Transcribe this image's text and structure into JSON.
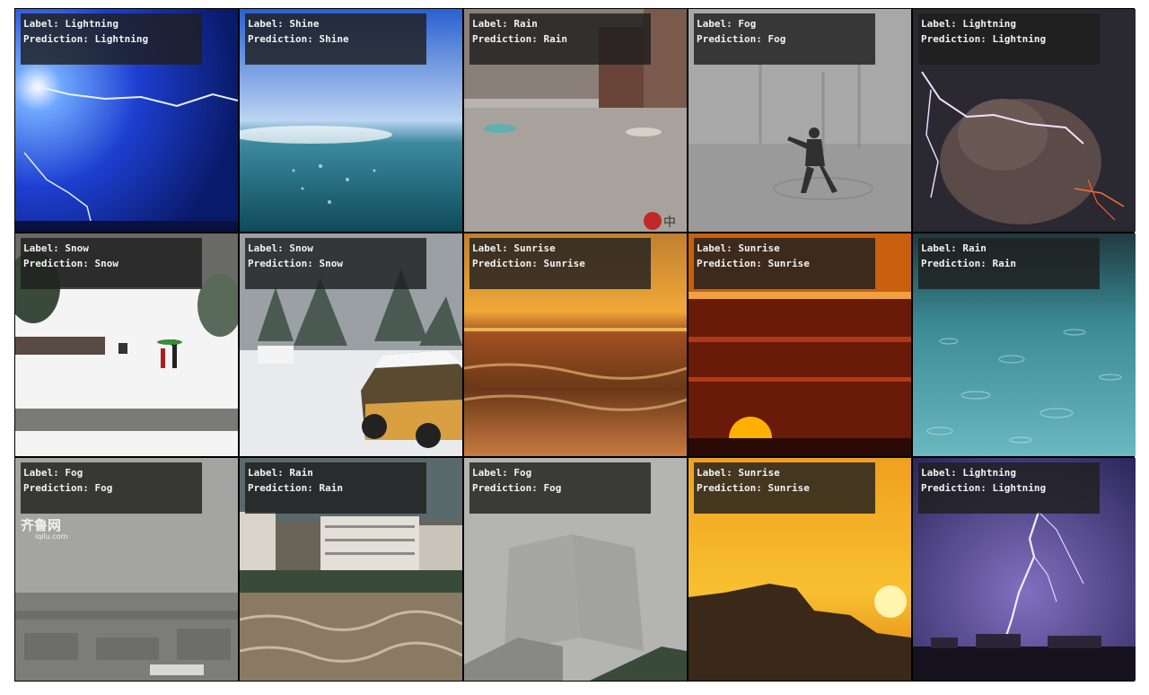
{
  "tiles": [
    {
      "label": "Label: Lightning",
      "prediction": "Prediction: Lightning",
      "scene": "lightning-sky-icon"
    },
    {
      "label": "Label: Shine",
      "prediction": "Prediction: Shine",
      "scene": "sunny-sea-icon"
    },
    {
      "label": "Label: Rain",
      "prediction": "Prediction: Rain",
      "scene": "flooded-street-icon"
    },
    {
      "label": "Label: Fog",
      "prediction": "Prediction: Fog",
      "scene": "foggy-person-icon"
    },
    {
      "label": "Label: Lightning",
      "prediction": "Prediction: Lightning",
      "scene": "volcanic-lightning-icon"
    },
    {
      "label": "Label: Snow",
      "prediction": "Prediction: Snow",
      "scene": "snowy-park-icon"
    },
    {
      "label": "Label: Snow",
      "prediction": "Prediction: Snow",
      "scene": "snowy-car-icon"
    },
    {
      "label": "Label: Sunrise",
      "prediction": "Prediction: Sunrise",
      "scene": "sunrise-beach-icon"
    },
    {
      "label": "Label: Sunrise",
      "prediction": "Prediction: Sunrise",
      "scene": "red-sunrise-icon"
    },
    {
      "label": "Label: Rain",
      "prediction": "Prediction: Rain",
      "scene": "rain-water-icon"
    },
    {
      "label": "Label: Fog",
      "prediction": "Prediction: Fog",
      "scene": "foggy-city-icon"
    },
    {
      "label": "Label: Rain",
      "prediction": "Prediction: Rain",
      "scene": "flood-river-icon"
    },
    {
      "label": "Label: Fog",
      "prediction": "Prediction: Fog",
      "scene": "foggy-tower-icon"
    },
    {
      "label": "Label: Sunrise",
      "prediction": "Prediction: Sunrise",
      "scene": "mountain-sunrise-icon"
    },
    {
      "label": "Label: Lightning",
      "prediction": "Prediction: Lightning",
      "scene": "night-lightning-icon"
    }
  ],
  "watermarks": {
    "qilu": "齐鲁网",
    "qilu_sub": "iqilu.com",
    "stamp": "中"
  }
}
